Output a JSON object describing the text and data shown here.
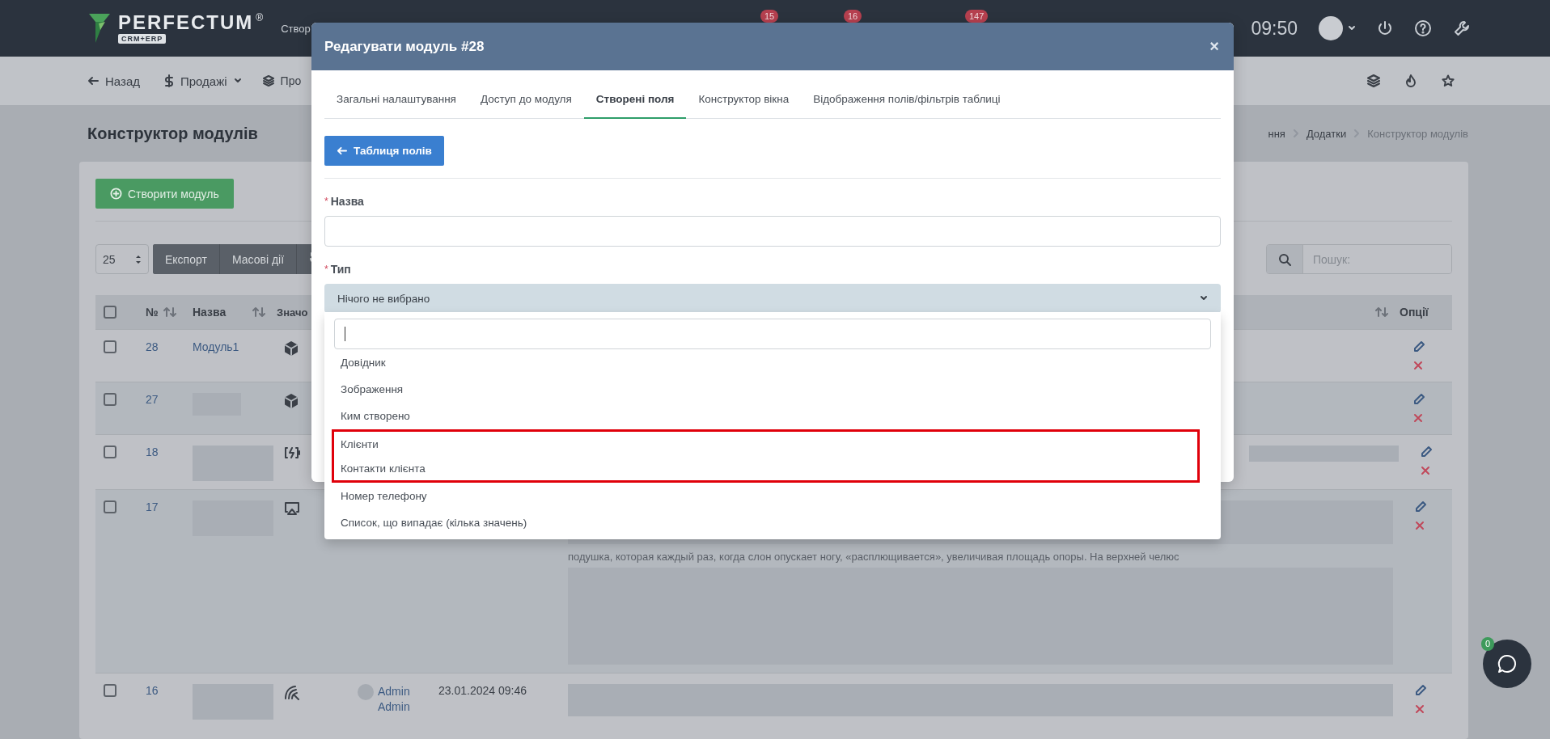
{
  "topbar": {
    "logo": "PERFECTUM",
    "logo_mark": "®",
    "logo_sub": "CRM+ERP",
    "menu_label": "Створ",
    "badges": [
      "15",
      "16",
      "147"
    ],
    "time": "09:50"
  },
  "subbar": {
    "back": "Назад",
    "menus": [
      {
        "label": "Продажі"
      },
      {
        "label": "Про"
      }
    ]
  },
  "page": {
    "title": "Конструктор модулів",
    "breadcrumbs": [
      {
        "label": "ння"
      },
      {
        "label": "Додатки"
      },
      {
        "label": "Конструктор модулів"
      }
    ],
    "create_button": "Створити модуль",
    "page_size": "25",
    "toolbar_buttons": [
      "Експорт",
      "Масові дії"
    ],
    "search": {
      "placeholder": "Пошук:"
    }
  },
  "table": {
    "select_all": {
      "checked": false
    },
    "columns": [
      {
        "label": "№"
      },
      {
        "label": "Назва"
      },
      {
        "label": "Значо"
      },
      {
        "label": "Опції"
      }
    ],
    "rows": [
      {
        "number": "28",
        "name": "Модуль1",
        "checked": false
      },
      {
        "number": "27",
        "checked": false
      },
      {
        "number": "18",
        "checked": false
      },
      {
        "number": "17",
        "checked": false,
        "description": "подушка, которая каждый раз, когда слон опускает ногу, «расплющивается», увеличивая площадь опоры. На верхней челюс"
      },
      {
        "number": "16",
        "checked": false,
        "author": "Admin Admin",
        "date": "23.01.2024 09:46"
      }
    ]
  },
  "modal": {
    "title": "Редагувати модуль #28",
    "close": "×",
    "tabs": [
      {
        "label": "Загальні налаштування",
        "selected": false
      },
      {
        "label": "Доступ до модуля",
        "selected": false
      },
      {
        "label": "Створені поля",
        "selected": true
      },
      {
        "label": "Конструктор вікна",
        "selected": false
      },
      {
        "label": "Відображення полів/фільтрів таблиці",
        "selected": false
      }
    ],
    "back_button": "Таблиця полів",
    "fields": [
      {
        "kind": "text",
        "label": "Назва",
        "required_mark": "*"
      },
      {
        "kind": "select",
        "label": "Тип",
        "required_mark": "*",
        "value": "Нічого не вибрано",
        "expanded": true
      }
    ],
    "options": [
      {
        "label": "Довідник",
        "annotated": false
      },
      {
        "label": "Зображення",
        "annotated": false
      },
      {
        "label": "Ким створено",
        "annotated": false
      },
      {
        "label": "Клієнти",
        "annotated": true
      },
      {
        "label": "Контакти клієнта",
        "annotated": true
      },
      {
        "label": "Номер телефону",
        "annotated": false
      },
      {
        "label": "Список, що випадає (кілька значень)",
        "annotated": false
      }
    ]
  },
  "chat": {
    "badge": "0"
  }
}
